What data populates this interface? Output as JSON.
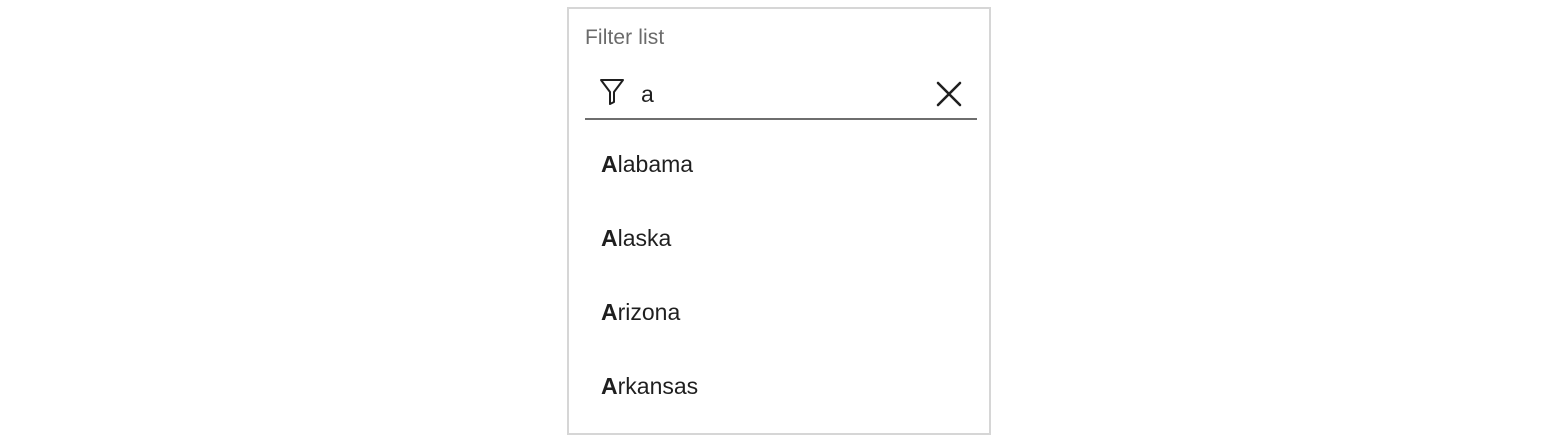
{
  "filter": {
    "label": "Filter list",
    "value": "a",
    "icon": "funnel-icon",
    "clear_icon": "close-icon"
  },
  "results": [
    {
      "match": "A",
      "rest": "labama"
    },
    {
      "match": "A",
      "rest": "laska"
    },
    {
      "match": "A",
      "rest": "rizona"
    },
    {
      "match": "A",
      "rest": "rkansas"
    }
  ]
}
